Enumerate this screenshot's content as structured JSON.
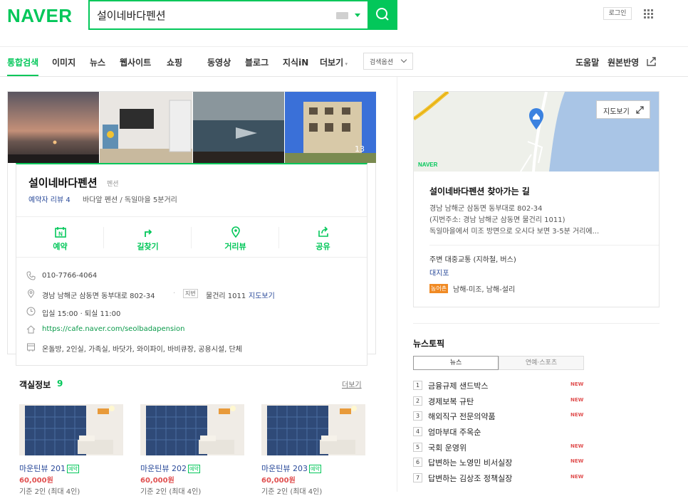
{
  "header": {
    "logo": "NAVER",
    "search_query": "설이네바다펜션",
    "login_label": "로그인"
  },
  "tabs": {
    "items": [
      "통합검색",
      "이미지",
      "뉴스",
      "웹사이트",
      "쇼핑",
      "동영상",
      "블로그",
      "지식iN",
      "더보기"
    ],
    "active": "통합검색",
    "search_options": "검색옵션",
    "help": "도움말",
    "feedback": "원본반영"
  },
  "place": {
    "photo_count": "13",
    "name": "설이네바다펜션",
    "category": "펜션",
    "review_label": "예약자 리뷰 4",
    "description": "바다앞 펜션 / 독일마을 5분거리",
    "actions": [
      "예약",
      "길찾기",
      "거리뷰",
      "공유"
    ],
    "phone": "010-7766-4064",
    "address": "경남 남해군 삼동면 동부대로 802-34",
    "jibun_badge": "지번",
    "jibun": "물건리 1011",
    "map_link": "지도보기",
    "hours": "입실 15:00 · 퇴실 11:00",
    "website": "https://cafe.naver.com/seolbadapension",
    "amenities": "온돌방, 2인실, 가족실, 바닷가, 와이파이, 바비큐장, 공용시설, 단체"
  },
  "rooms": {
    "title": "객실정보",
    "count": "9",
    "more": "더보기",
    "items": [
      {
        "name": "마운틴뷰 201",
        "badge": "예약",
        "price": "60,000원",
        "capacity": "기준 2인 (최대 4인)"
      },
      {
        "name": "마운틴뷰 202",
        "badge": "예약",
        "price": "60,000원",
        "capacity": "기준 2인 (최대 4인)"
      },
      {
        "name": "마운틴뷰 203",
        "badge": "예약",
        "price": "60,000원",
        "capacity": "기준 2인 (최대 4인)"
      }
    ]
  },
  "map": {
    "button": "지도보기",
    "logo": "NAVER",
    "route_title": "설이네바다펜션 찾아가는 길",
    "address_lines": [
      "경남 남해군 삼동면 동부대로 802-34",
      "(지번주소: 경남 남해군 삼동면 물건리 1011)",
      "독일마을에서 미조 방면으로 오시다 보면 3-5분 거리에..."
    ],
    "transit_title": "주변 대중교통 (지하철, 버스)",
    "transit_stop": "대지포",
    "bus_badge": "농어촌",
    "bus_routes": "남해-미조, 남해-설리"
  },
  "news": {
    "title": "뉴스토픽",
    "tabs": [
      "뉴스",
      "연예·스포츠"
    ],
    "items": [
      {
        "rank": "1",
        "title": "금융규제 샌드박스",
        "new": "NEW"
      },
      {
        "rank": "2",
        "title": "경제보복 규탄",
        "new": "NEW"
      },
      {
        "rank": "3",
        "title": "해외직구 전문의약품",
        "new": "NEW"
      },
      {
        "rank": "4",
        "title": "엄마부대 주옥순",
        "new": ""
      },
      {
        "rank": "5",
        "title": "국회 운영위",
        "new": "NEW"
      },
      {
        "rank": "6",
        "title": "답변하는 노영민 비서실장",
        "new": "NEW"
      },
      {
        "rank": "7",
        "title": "답변하는 김상조 정책실장",
        "new": "NEW"
      }
    ]
  }
}
